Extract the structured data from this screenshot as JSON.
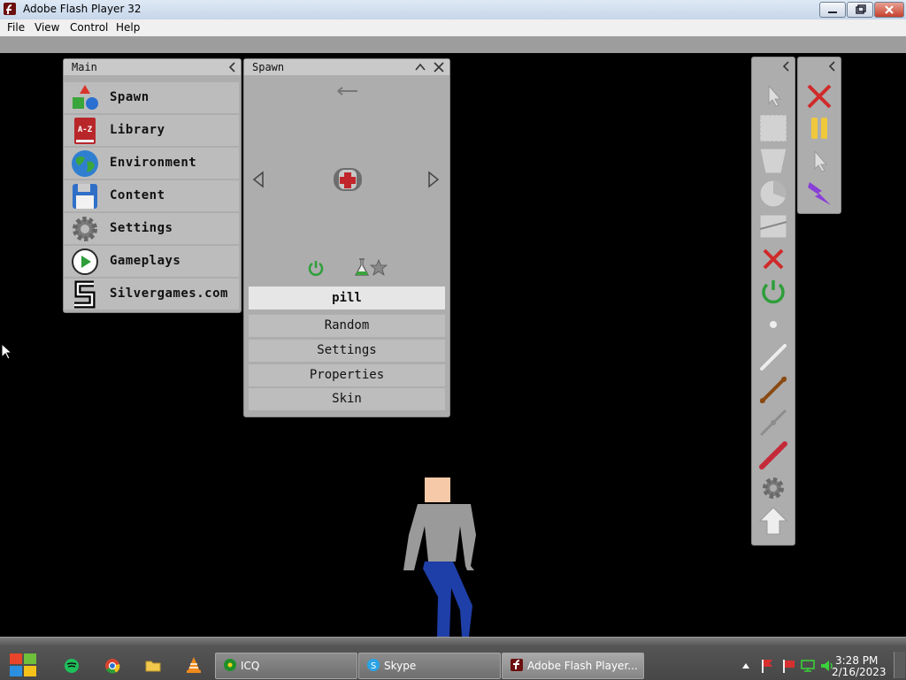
{
  "window": {
    "title": "Adobe Flash Player 32"
  },
  "menu": {
    "file": "File",
    "view": "View",
    "control": "Control",
    "help": "Help"
  },
  "main_panel": {
    "title": "Main",
    "items": [
      {
        "label": "Spawn",
        "icon": "shapes-icon"
      },
      {
        "label": "Library",
        "icon": "book-az-icon"
      },
      {
        "label": "Environment",
        "icon": "globe-icon"
      },
      {
        "label": "Content",
        "icon": "floppy-disk-icon"
      },
      {
        "label": "Settings",
        "icon": "gear-icon"
      },
      {
        "label": "Gameplays",
        "icon": "play-icon"
      },
      {
        "label": "Silvergames.com",
        "icon": "silvergames-logo-icon"
      }
    ]
  },
  "spawn_panel": {
    "title": "Spawn",
    "selected_item": "pill",
    "buttons": [
      "Random",
      "Settings",
      "Properties",
      "Skin"
    ]
  },
  "taskbar": {
    "apps": [
      {
        "label": "ICQ"
      },
      {
        "label": "Skype"
      },
      {
        "label": "Adobe Flash Player..."
      }
    ],
    "time": "3:28 PM",
    "date": "2/16/2023"
  },
  "colors": {
    "panel": "#adadad",
    "panel_header": "#c9c9c9",
    "stage": "#000000",
    "shirt": "#9a9a9a",
    "pants": "#1f3fa8",
    "skin": "#f6c9a8"
  }
}
